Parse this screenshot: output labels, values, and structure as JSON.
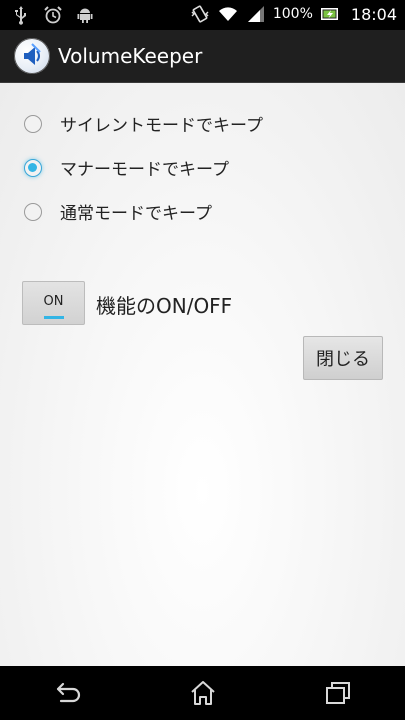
{
  "status_bar": {
    "battery_percent": "100%",
    "time": "18:04",
    "left_icons": [
      "usb-icon",
      "alarm-icon",
      "android-icon"
    ],
    "right_icons": [
      "vibrate-icon",
      "wifi-icon",
      "signal-icon",
      "battery-charging-icon"
    ]
  },
  "action_bar": {
    "title": "VolumeKeeper",
    "icon": "speaker-app-icon"
  },
  "modes": [
    {
      "label": "サイレントモードでキープ",
      "checked": false
    },
    {
      "label": "マナーモードでキープ",
      "checked": true
    },
    {
      "label": "通常モードでキープ",
      "checked": false
    }
  ],
  "toggle": {
    "state_text": "ON",
    "label": "機能のON/OFF"
  },
  "close_button": {
    "label": "閉じる"
  },
  "nav_bar": {
    "icons": [
      "back-icon",
      "home-icon",
      "recent-apps-icon"
    ]
  },
  "colors": {
    "accent": "#33b5e5",
    "action_bar": "#1f1f1f"
  }
}
